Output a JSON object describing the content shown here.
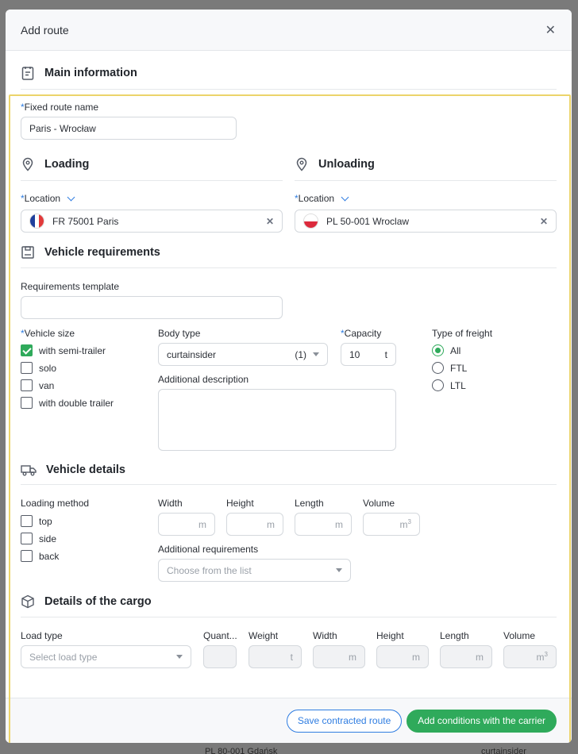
{
  "modal": {
    "title": "Add route"
  },
  "sections": {
    "main": "Main information",
    "loading": "Loading",
    "unloading": "Unloading",
    "vehicle_req": "Vehicle requirements",
    "vehicle_details": "Vehicle details",
    "cargo": "Details of the cargo"
  },
  "fixed_route": {
    "label": "Fixed route name",
    "value": "Paris - Wrocław"
  },
  "loading": {
    "label": "Location",
    "value": "FR 75001 Paris",
    "flag": "fr"
  },
  "unloading": {
    "label": "Location",
    "value": "PL 50-001 Wroclaw",
    "flag": "pl"
  },
  "requirements_template": {
    "label": "Requirements template",
    "value": ""
  },
  "vehicle_size": {
    "label": "Vehicle size",
    "options": [
      {
        "label": "with semi-trailer",
        "checked": true
      },
      {
        "label": "solo",
        "checked": false
      },
      {
        "label": "van",
        "checked": false
      },
      {
        "label": "with double trailer",
        "checked": false
      }
    ]
  },
  "body_type": {
    "label": "Body type",
    "value": "curtainsider",
    "count": "(1)"
  },
  "capacity": {
    "label": "Capacity",
    "value": "10",
    "unit": "t"
  },
  "freight_type": {
    "label": "Type of freight",
    "options": [
      {
        "label": "All",
        "selected": true
      },
      {
        "label": "FTL",
        "selected": false
      },
      {
        "label": "LTL",
        "selected": false
      }
    ]
  },
  "additional_description": {
    "label": "Additional description"
  },
  "loading_method": {
    "label": "Loading method",
    "options": [
      "top",
      "side",
      "back"
    ]
  },
  "dims": {
    "width": "Width",
    "height": "Height",
    "length": "Length",
    "volume": "Volume",
    "unit_m": "m",
    "unit_m3": "m"
  },
  "additional_requirements": {
    "label": "Additional requirements",
    "placeholder": "Choose from the list"
  },
  "cargo": {
    "load_type": "Load type",
    "load_type_placeholder": "Select load type",
    "quantity": "Quant...",
    "weight": "Weight",
    "unit_t": "t"
  },
  "footer": {
    "save": "Save contracted route",
    "add": "Add conditions with the carrier"
  },
  "backdrop": {
    "bottom_text": "PL 80-001 Gdańsk",
    "bottom_right": "curtainsider"
  },
  "colors": {
    "accent_green": "#2faa5b",
    "accent_blue": "#2f7de1",
    "highlight": "#ecd46a"
  }
}
